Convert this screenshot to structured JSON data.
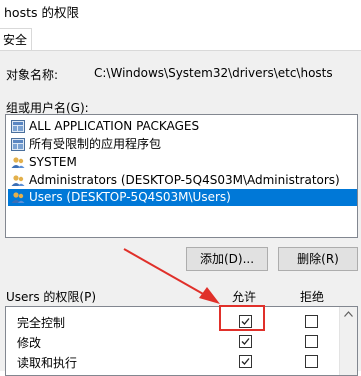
{
  "window": {
    "title": "hosts 的权限"
  },
  "tabs": [
    {
      "label": "安全"
    }
  ],
  "object": {
    "label": "对象名称:",
    "path": "C:\\Windows\\System32\\drivers\\etc\\hosts"
  },
  "groups": {
    "label": "组或用户名(G):",
    "items": [
      {
        "label": "ALL APPLICATION PACKAGES",
        "icon": "group-icon",
        "selected": false
      },
      {
        "label": "所有受限制的应用程序包",
        "icon": "group-icon",
        "selected": false
      },
      {
        "label": "SYSTEM",
        "icon": "users-icon",
        "selected": false
      },
      {
        "label": "Administrators (DESKTOP-5Q4S03M\\Administrators)",
        "icon": "users-icon",
        "selected": false
      },
      {
        "label": "Users (DESKTOP-5Q4S03M\\Users)",
        "icon": "users-icon",
        "selected": true
      }
    ]
  },
  "buttons": {
    "add": "添加(D)...",
    "remove": "删除(R)"
  },
  "permissions": {
    "label": "Users 的权限(P)",
    "allow": "允许",
    "deny": "拒绝",
    "rows": [
      {
        "name": "完全控制",
        "allow": true,
        "deny": false
      },
      {
        "name": "修改",
        "allow": true,
        "deny": false
      },
      {
        "name": "读取和执行",
        "allow": true,
        "deny": false
      }
    ]
  },
  "colors": {
    "selection": "#0078d7",
    "annotation": "#e0302a"
  }
}
